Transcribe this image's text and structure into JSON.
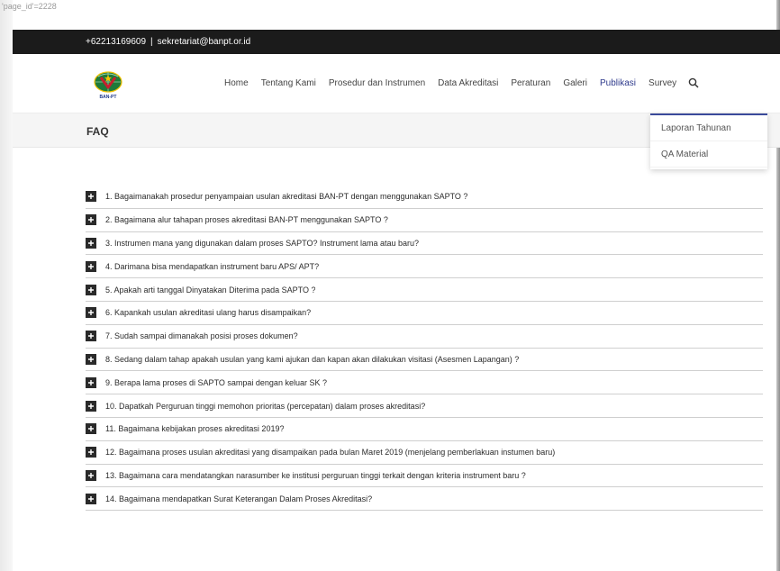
{
  "page_id_label": "'page_id'=2228",
  "topbar": {
    "phone": "+62213169609",
    "separator": "|",
    "email": "sekretariat@banpt.or.id"
  },
  "logo": {
    "text": "BAN-PT",
    "colors": {
      "globe": "#1f7a3a",
      "ribbon": "#c8202e",
      "star": "#f2c200"
    }
  },
  "nav": {
    "items": [
      "Home",
      "Tentang Kami",
      "Prosedur dan Instrumen",
      "Data Akreditasi",
      "Peraturan",
      "Galeri",
      "Publikasi",
      "Survey"
    ],
    "active": "Publikasi",
    "search_icon": "search-icon"
  },
  "dropdown": {
    "items": [
      "Laporan Tahunan",
      "QA Material"
    ]
  },
  "page_title": "FAQ",
  "faq": [
    "1. Bagaimanakah prosedur penyampaian usulan akreditasi BAN-PT dengan menggunakan SAPTO ?",
    "2. Bagaimana alur tahapan proses akreditasi BAN-PT menggunakan SAPTO ?",
    "3. Instrumen mana yang digunakan dalam proses SAPTO? Instrument lama atau baru?",
    "4. Darimana bisa mendapatkan instrument baru APS/ APT?",
    "5. Apakah arti tanggal Dinyatakan Diterima pada SAPTO ?",
    "6. Kapankah usulan akreditasi ulang harus disampaikan?",
    "7. Sudah sampai dimanakah posisi proses dokumen?",
    "8. Sedang dalam tahap apakah usulan yang kami ajukan dan kapan akan dilakukan visitasi (Asesmen Lapangan) ?",
    "9. Berapa lama proses di SAPTO sampai dengan keluar SK ?",
    "10. Dapatkah Perguruan tinggi memohon prioritas (percepatan) dalam proses akreditasi?",
    "11. Bagaimana kebijakan proses akreditasi 2019?",
    "12. Bagaimana proses usulan akreditasi yang disampaikan pada bulan Maret 2019 (menjelang pemberlakuan instumen baru)",
    "13. Bagaimana cara mendatangkan narasumber ke institusi perguruan tinggi terkait dengan kriteria instrument baru ?",
    "14. Bagaimana mendapatkan Surat Keterangan Dalam Proses Akreditasi?"
  ],
  "colors": {
    "topbar_bg": "#1b1b1b",
    "active_nav": "#2e3a8c",
    "title_bg": "#f5f5f5",
    "plus_box": "#2a2a2a"
  }
}
